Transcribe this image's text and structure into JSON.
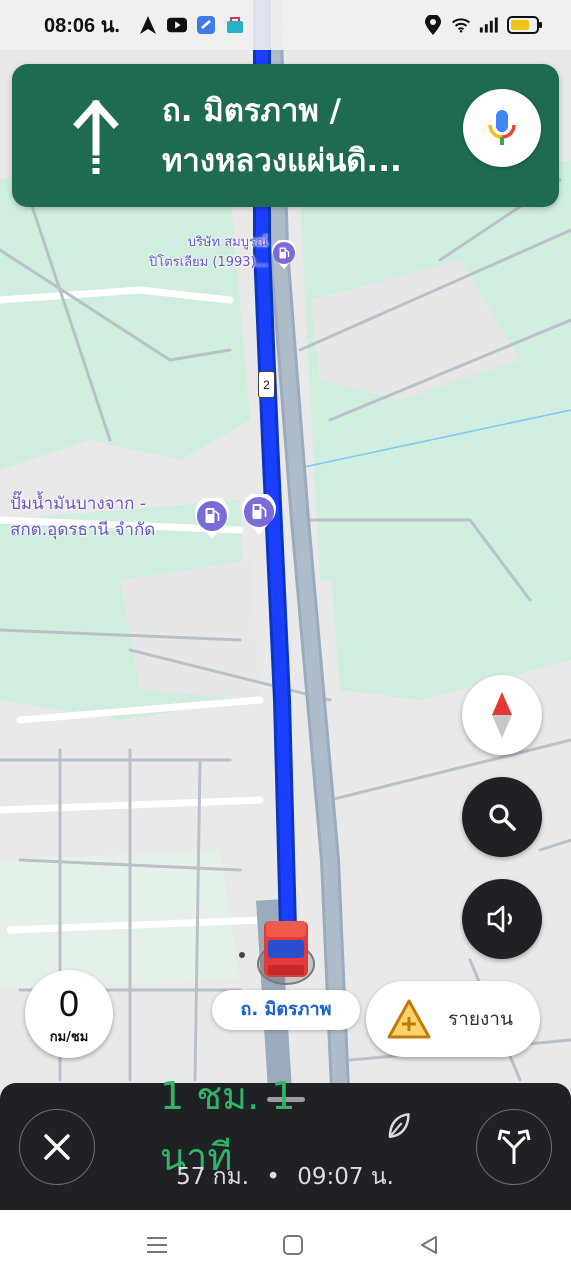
{
  "status_bar": {
    "time": "08:06 น.",
    "left_icons": [
      "navigation-icon",
      "youtube-icon",
      "app-icon",
      "bag-app-icon"
    ],
    "right_icons": [
      "location-icon",
      "wifi-icon",
      "signal-icon",
      "battery-icon"
    ]
  },
  "navigation": {
    "maneuver_icon": "straight-arrow-icon",
    "street_line1": "ถ. มิตรภาพ /",
    "street_line2": "ทางหลวงแผ่นดิ...",
    "banner_color": "#1e6b4f"
  },
  "map": {
    "pois": [
      {
        "line1": "บริษัท สมบูรณ์",
        "line2": "ปิโตรเลียม (1993)...",
        "icon": "gas-station-icon"
      },
      {
        "line1": "ปั๊มน้ำมันบางจาก -",
        "line2": "สกต.อุดรธานี จำกัด",
        "icon": "gas-station-icon"
      }
    ],
    "route_shield": "2",
    "route_color": "#1a3fff"
  },
  "controls": {
    "compass": "compass-icon",
    "search": "search-icon",
    "sound": "volume-icon"
  },
  "speed": {
    "value": "0",
    "unit": "กม/ชม"
  },
  "current_street": "ถ. มิตรภาพ",
  "report": {
    "label": "รายงาน",
    "icon": "report-incident-icon"
  },
  "trip": {
    "duration": "1 ชม. 1 นาที",
    "distance": "57 กม.",
    "separator": "•",
    "arrival": "09:07 น.",
    "duration_color": "#2fb569"
  }
}
